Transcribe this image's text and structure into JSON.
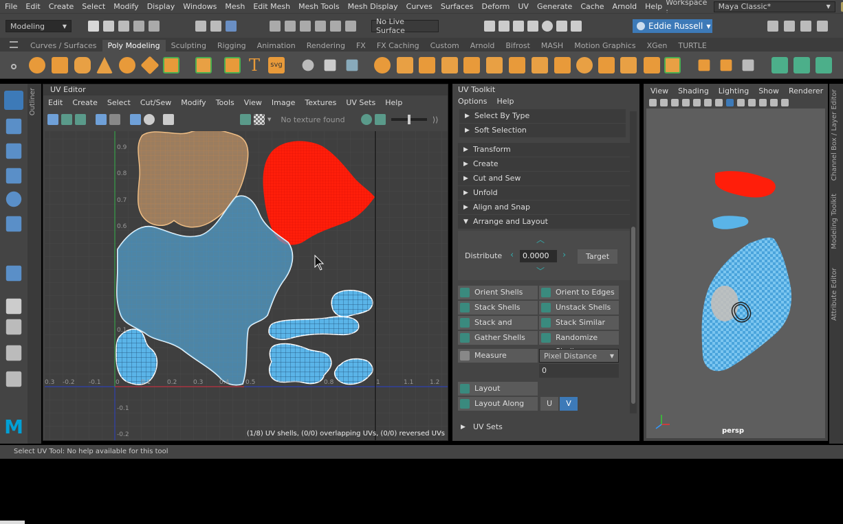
{
  "menubar": {
    "items": [
      "File",
      "Edit",
      "Create",
      "Select",
      "Modify",
      "Display",
      "Windows",
      "Mesh",
      "Edit Mesh",
      "Mesh Tools",
      "Mesh Display",
      "Curves",
      "Surfaces",
      "Deform",
      "UV",
      "Generate",
      "Cache",
      "Arnold",
      "Help"
    ],
    "workspace_label": "Workspace :",
    "workspace_value": "Maya Classic*"
  },
  "statusline": {
    "mode": "Modeling",
    "live_surface": "No Live Surface",
    "user": "Eddie Russell"
  },
  "shelf": {
    "tabs": [
      "Curves / Surfaces",
      "Poly Modeling",
      "Sculpting",
      "Rigging",
      "Animation",
      "Rendering",
      "FX",
      "FX Caching",
      "Custom",
      "Arnold",
      "Bifrost",
      "MASH",
      "Motion Graphics",
      "XGen",
      "TURTLE"
    ],
    "active_tab": "Poly Modeling",
    "text_icon": "T",
    "svg_icon": "svg"
  },
  "uv_editor": {
    "title": "UV Editor",
    "menu": [
      "Edit",
      "Create",
      "Select",
      "Cut/Sew",
      "Modify",
      "Tools",
      "View",
      "Image",
      "Textures",
      "UV Sets",
      "Help"
    ],
    "texture_status": "No texture found",
    "info": "(1/8) UV shells, (0/0) overlapping UVs, (0/0) reversed UVs",
    "y_ticks": [
      "0.9",
      "0.8",
      "0.7",
      "0.6",
      "0.1",
      "-0.1",
      "-0.2"
    ],
    "x_ticks": [
      "0.3",
      "-0.2",
      "-0.1",
      "0",
      "0.1",
      "0.2",
      "0.3",
      "0.4",
      "0.5",
      "0.8",
      "1",
      "1.1",
      "1.2"
    ]
  },
  "uv_toolkit": {
    "title": "UV Toolkit",
    "menu": [
      "Options",
      "Help"
    ],
    "sub_sections": [
      "Select By Type",
      "Soft Selection"
    ],
    "sections": [
      "Transform",
      "Create",
      "Cut and Sew",
      "Unfold",
      "Align and Snap",
      "Arrange and Layout"
    ],
    "distribute_label": "Distribute",
    "distribute_value": "0.0000",
    "target_label": "Target",
    "buttons": [
      [
        "Orient Shells",
        "Orient to Edges"
      ],
      [
        "Stack Shells",
        "Unstack Shells"
      ],
      [
        "Stack and Orient",
        "Stack Similar"
      ],
      [
        "Gather Shells",
        "Randomize Shells"
      ]
    ],
    "measure_label": "Measure",
    "measure_mode": "Pixel Distance",
    "measure_value": "0",
    "layout_label": "Layout",
    "layout_along_label": "Layout Along",
    "u_label": "U",
    "v_label": "V",
    "uv_sets_label": "UV Sets"
  },
  "viewport": {
    "menu": [
      "View",
      "Shading",
      "Lighting",
      "Show",
      "Renderer"
    ],
    "camera_label": "persp"
  },
  "side_tabs": [
    "Channel Box / Layer Editor",
    "Modeling Toolkit",
    "Attribute Editor"
  ],
  "outliner_label": "Outliner",
  "help_line": "Select UV Tool: No help available for this tool",
  "colors": {
    "accent_blue": "#3d7ab8",
    "shell_blue": "#5ab4e8",
    "shell_orange": "#e8b07a",
    "shell_red": "#ff1e0a",
    "maya_logo": "#00a0d6"
  }
}
